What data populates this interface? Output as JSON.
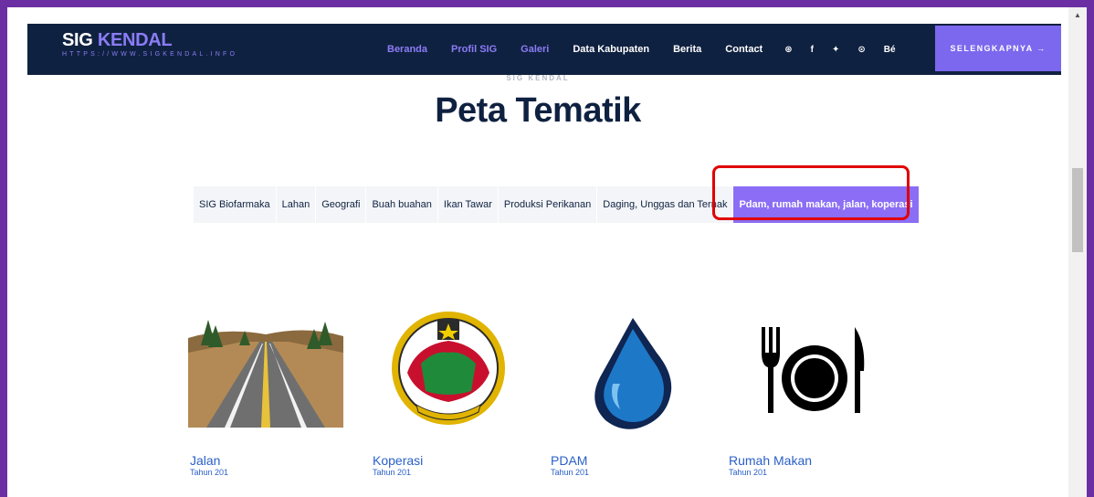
{
  "brand": {
    "title_main": "SIG ",
    "title_accent": "KENDAL",
    "subtitle": "HTTPS://WWW.SIGKENDAL.INFO"
  },
  "nav": {
    "links": [
      {
        "label": "Beranda",
        "active": true
      },
      {
        "label": "Profil SIG",
        "active": true
      },
      {
        "label": "Galeri",
        "active": true
      },
      {
        "label": "Data Kabupaten",
        "active": false
      },
      {
        "label": "Berita",
        "active": false
      },
      {
        "label": "Contact",
        "active": false
      }
    ],
    "social": [
      "⊛",
      "f",
      "✦",
      "⊙",
      "Bé"
    ],
    "cta": "SELENGKAPNYA →"
  },
  "section": {
    "eyebrow": "SIG KENDAL",
    "title": "Peta Tematik"
  },
  "filters": [
    {
      "label": "SIG Biofarmaka"
    },
    {
      "label": "Lahan"
    },
    {
      "label": "Geografi"
    },
    {
      "label": "Buah buahan"
    },
    {
      "label": "Ikan Tawar"
    },
    {
      "label": "Produksi Perikanan"
    },
    {
      "label": "Daging, Unggas dan Ternak"
    },
    {
      "label": "Pdam, rumah makan, jalan, koperasi",
      "active": true
    }
  ],
  "cards": [
    {
      "title": "Jalan",
      "sub": "Tahun 201"
    },
    {
      "title": "Koperasi",
      "sub": "Tahun 201"
    },
    {
      "title": "PDAM",
      "sub": "Tahun 201"
    },
    {
      "title": "Rumah Makan",
      "sub": "Tahun 201"
    }
  ],
  "colors": {
    "navy": "#0f2140",
    "accent": "#8b7cf6",
    "active_filter": "#8b6ef5",
    "highlight": "#e00000",
    "link": "#2a60c8"
  }
}
